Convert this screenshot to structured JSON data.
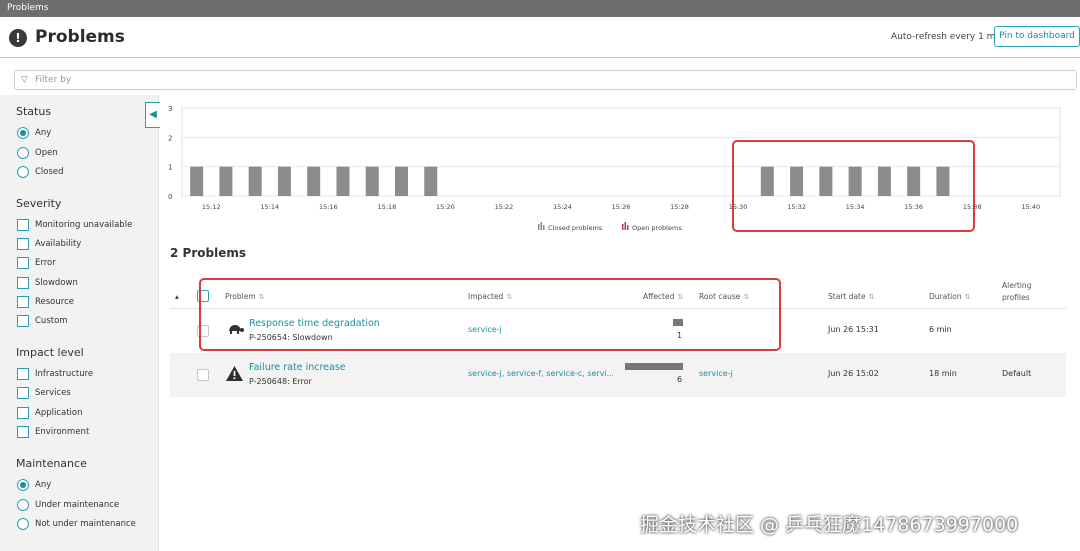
{
  "window": {
    "tab_title": "Problems"
  },
  "header": {
    "title": "Problems",
    "icon": "alert-circle-icon",
    "auto_refresh": "Auto-refresh every 1 min",
    "pin_label": "Pin to dashboard"
  },
  "filter": {
    "placeholder": "Filter by",
    "icon": "filter-icon"
  },
  "sidebar": {
    "status": {
      "heading": "Status",
      "items": [
        "Any",
        "Open",
        "Closed"
      ],
      "selected": "Any"
    },
    "severity": {
      "heading": "Severity",
      "items": [
        "Monitoring unavailable",
        "Availability",
        "Error",
        "Slowdown",
        "Resource",
        "Custom"
      ]
    },
    "impact": {
      "heading": "Impact level",
      "items": [
        "Infrastructure",
        "Services",
        "Application",
        "Environment"
      ]
    },
    "maintenance": {
      "heading": "Maintenance",
      "items": [
        "Any",
        "Under maintenance",
        "Not under maintenance"
      ],
      "selected": "Any"
    }
  },
  "chart_data": {
    "type": "bar",
    "title": "",
    "y_ticks": [
      "0",
      "1",
      "2",
      "3"
    ],
    "ylim": [
      0,
      3
    ],
    "x_ticks": [
      "15:12",
      "15:14",
      "15:16",
      "15:18",
      "15:20",
      "15:22",
      "15:24",
      "15:26",
      "15:28",
      "15:30",
      "15:32",
      "15:34",
      "15:36",
      "15:38",
      "15:40"
    ],
    "series": [
      {
        "name": "Closed problems",
        "color": "#8c8c8c",
        "x": [
          "15:11.5",
          "15:12.5",
          "15:13.5",
          "15:14.5",
          "15:15.5",
          "15:16.5",
          "15:17.5",
          "15:18.5",
          "15:19.5",
          "15:31",
          "15:32",
          "15:33",
          "15:34",
          "15:35",
          "15:36",
          "15:37"
        ],
        "values": [
          1,
          1,
          1,
          1,
          1,
          1,
          1,
          1,
          1,
          1,
          1,
          1,
          1,
          1,
          1,
          1
        ]
      },
      {
        "name": "Open problems",
        "color": "#c8344a",
        "x": [],
        "values": []
      }
    ],
    "legend": [
      "Closed problems",
      "Open problems"
    ],
    "legend_placement": "bottom-center",
    "grid": true
  },
  "main": {
    "count_title": "2 Problems"
  },
  "table": {
    "headers": {
      "problem": "Problem",
      "impacted": "Impacted",
      "affected": "Affected",
      "root_cause": "Root cause",
      "start_date": "Start date",
      "duration": "Duration",
      "alerting_profiles": "Alerting profiles"
    },
    "rows": [
      {
        "icon": "turtle-icon",
        "name": "Response time degradation",
        "id": "P-250654: Slowdown",
        "impacted": "service-j",
        "affected": "1",
        "affected_fraction": 0.17,
        "root_cause": "",
        "start_date": "Jun 26 15:31",
        "duration": "6 min",
        "alerting_profile": ""
      },
      {
        "icon": "warning-triangle-icon",
        "name": "Failure rate increase",
        "id": "P-250648: Error",
        "impacted": "service-j, service-f, service-c, servi...",
        "affected": "6",
        "affected_fraction": 1.0,
        "root_cause": "service-j",
        "start_date": "Jun 26 15:02",
        "duration": "18 min",
        "alerting_profile": "Default"
      }
    ]
  },
  "watermark": "掘金技术社区 @ 乒乓狂魔1478673997000"
}
